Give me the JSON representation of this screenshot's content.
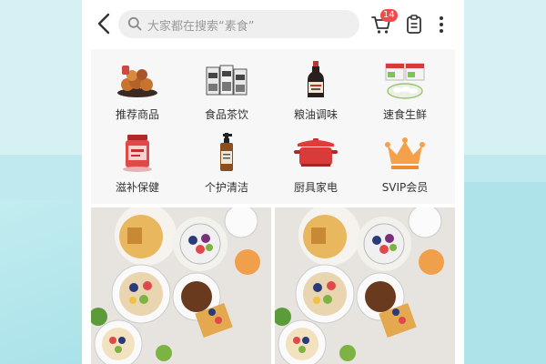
{
  "header": {
    "search_placeholder": "大家都在搜索“素食”",
    "cart_badge": "14",
    "icons": [
      "back-arrow-icon",
      "search-icon",
      "cart-icon",
      "clipboard-icon",
      "more-vertical-icon"
    ]
  },
  "categories": [
    {
      "label": "推荐商品",
      "icon": "snack-food-icon"
    },
    {
      "label": "食品茶饮",
      "icon": "tea-box-icon"
    },
    {
      "label": "粮油调味",
      "icon": "soy-sauce-bottle-icon"
    },
    {
      "label": "速食生鲜",
      "icon": "dumpling-pack-icon"
    },
    {
      "label": "滋补保健",
      "icon": "supplement-jar-icon"
    },
    {
      "label": "个护清洁",
      "icon": "pump-bottle-icon"
    },
    {
      "label": "厨具家电",
      "icon": "red-pot-icon"
    },
    {
      "label": "SVIP会员",
      "icon": "crown-icon"
    }
  ],
  "colors": {
    "badge": "#f24a4a",
    "crown": "#f5a04a",
    "pot": "#d93a3a",
    "background": "#bfe9ee"
  },
  "feed": {
    "cards": [
      {
        "image": "food-platter-photo"
      },
      {
        "image": "food-platter-photo"
      }
    ]
  }
}
